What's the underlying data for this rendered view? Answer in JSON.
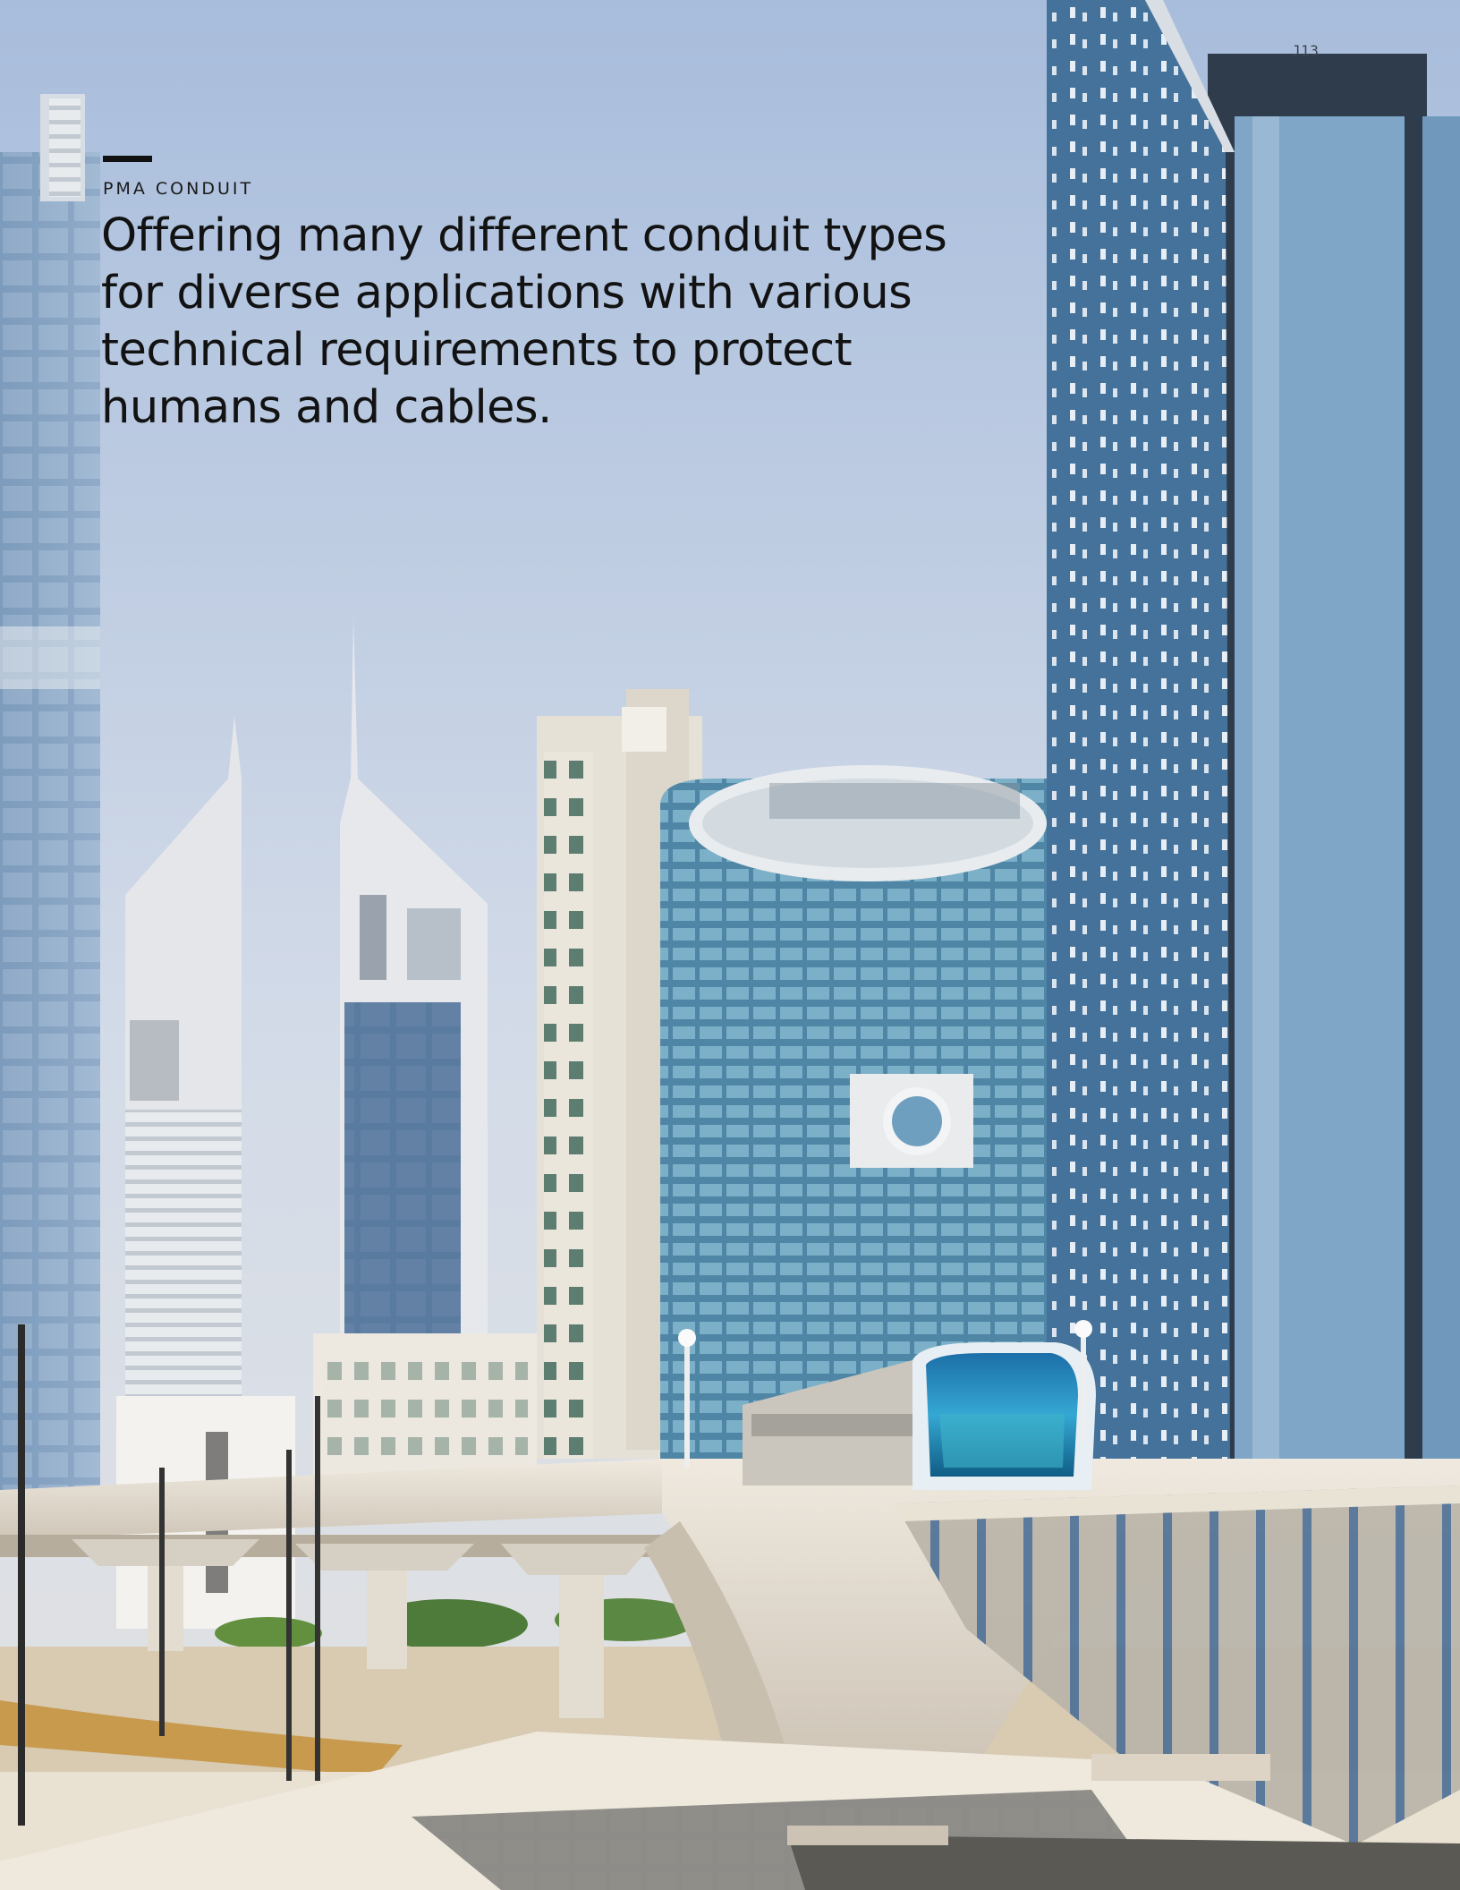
{
  "page": {
    "page_number": "J13",
    "kicker": "PMA CONDUIT",
    "headline": "Offering many different conduit types for diverse applications with various technical requirements to protect humans and cables."
  },
  "colors": {
    "sky_top": "#a9bedb",
    "sky_bottom": "#dfe4ec",
    "glass_blue": "#3f6a94",
    "concrete": "#e6e1d8",
    "train_accent": "#2a8fd6",
    "text": "#121212"
  },
  "figure": {
    "subject": "city-skyline-with-elevated-metro-train"
  }
}
